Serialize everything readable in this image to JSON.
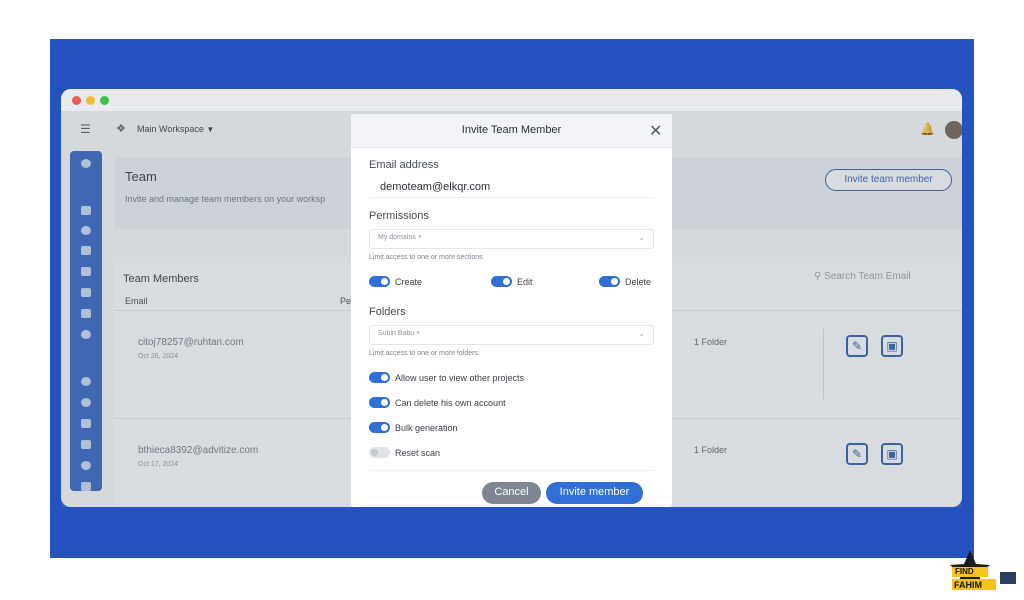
{
  "topbar": {
    "workspace_label": "Main Workspace",
    "menu_icon": "hamburger-icon",
    "bell_icon": "bell-icon"
  },
  "team": {
    "title": "Team",
    "subtitle": "Invite and manage team members on your worksp",
    "invite_button": "Invite team member"
  },
  "members": {
    "heading": "Team Members",
    "search_placeholder": "Search Team Email",
    "col_email": "Email",
    "col_pe": "Pe",
    "rows": [
      {
        "email": "citoj78257@ruhtan.com",
        "date": "Oct 26, 2024",
        "folder": "1 Folder"
      },
      {
        "email": "bthieca8392@advitize.com",
        "date": "Oct 17, 2024",
        "folder": "1 Folder"
      }
    ]
  },
  "modal": {
    "title": "Invite Team Member",
    "email_label": "Email address",
    "email_value": "demoteam@elkqr.com",
    "permissions_label": "Permissions",
    "permissions_chip": "My domains",
    "permissions_hint": "Limit access to one or more sections.",
    "perm_create": "Create",
    "perm_edit": "Edit",
    "perm_delete": "Delete",
    "folders_label": "Folders",
    "folders_chip": "Subin Babu",
    "folders_hint": "Limit access to one or more folders.",
    "opt_view_projects": "Allow user to view other projects",
    "opt_delete_account": "Can delete his own account",
    "opt_bulk": "Bulk generation",
    "opt_reset": "Reset scan",
    "cancel": "Cancel",
    "submit": "Invite member"
  },
  "watermark": {
    "line1": "FIND",
    "line2": "FAHIM"
  },
  "colors": {
    "frame": "#2453c0",
    "accent": "#2f6fd6",
    "cancel": "#7e8791",
    "sidebar": "#2a5dc2"
  }
}
